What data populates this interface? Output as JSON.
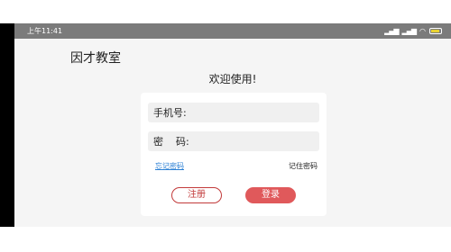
{
  "status_bar": {
    "time": "上午11:41",
    "icons": [
      "signal-icon",
      "signal-icon",
      "wifi-icon",
      "battery-icon"
    ]
  },
  "app": {
    "title": "因才教室",
    "welcome": "欢迎使用!"
  },
  "login_form": {
    "phone_label": "手机号:",
    "phone_value": "",
    "password_label": "密    码:",
    "password_value": "",
    "forgot_password": "忘记密码",
    "remember_password": "记住密码",
    "register_button": "注册",
    "login_button": "登录"
  },
  "colors": {
    "status_bar_bg": "#7b7b7b",
    "background": "#f5f5f5",
    "card": "#ffffff",
    "link": "#2a7fd4",
    "register_border": "#c23a3a",
    "login_bg": "#e0595b"
  }
}
